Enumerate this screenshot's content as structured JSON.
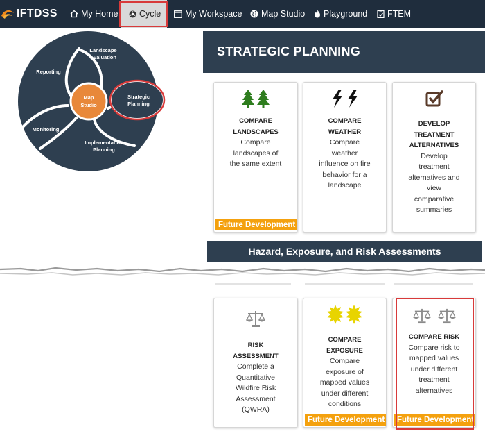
{
  "nav": {
    "brand": "IFTDSS",
    "items": [
      {
        "label": "My Home",
        "icon": "home-icon"
      },
      {
        "label": "Cycle",
        "icon": "cycle-icon",
        "active": true
      },
      {
        "label": "My Workspace",
        "icon": "window-icon"
      },
      {
        "label": "Map Studio",
        "icon": "globe-icon"
      },
      {
        "label": "Playground",
        "icon": "fire-icon"
      },
      {
        "label": "FTEM",
        "icon": "clipboard-icon"
      }
    ]
  },
  "cycle": {
    "center": [
      "Map",
      "Studio"
    ],
    "landscape": [
      "Landscape",
      "Evaluation"
    ],
    "reporting": "Reporting",
    "strategic": [
      "Strategic",
      "Planning"
    ],
    "monitoring": "Monitoring",
    "implementation": [
      "Implementation",
      "Planning"
    ]
  },
  "strategic": {
    "title": "STRATEGIC PLANNING",
    "cards": [
      {
        "title_lines": [
          "COMPARE",
          "LANDSCAPES"
        ],
        "desc_lines": [
          "Compare",
          "landscapes of",
          "the same extent"
        ],
        "icon": "tree-icon",
        "badge": "Future Development"
      },
      {
        "title_lines": [
          "COMPARE",
          "WEATHER"
        ],
        "desc_lines": [
          "Compare",
          "weather",
          "influence on fire",
          "behavior for a",
          "landscape"
        ],
        "icon": "lightning-icon"
      },
      {
        "title_lines": [
          "DEVELOP",
          "TREATMENT",
          "ALTERNATIVES"
        ],
        "desc_lines": [
          "Develop",
          "treatment",
          "alternatives and",
          "view",
          "comparative",
          "summaries"
        ],
        "icon": "checkbox-icon"
      }
    ]
  },
  "hazard": {
    "title": "Hazard, Exposure, and Risk Assessments",
    "cards": [
      {
        "title_lines": [
          "RISK",
          "ASSESSMENT"
        ],
        "desc_lines": [
          "Complete a",
          "Quantitative",
          "Wildfire Risk",
          "Assessment",
          "(QWRA)"
        ],
        "icon": "scale-icon"
      },
      {
        "title_lines": [
          "COMPARE",
          "EXPOSURE"
        ],
        "desc_lines": [
          "Compare",
          "exposure of",
          "mapped values",
          "under different",
          "conditions"
        ],
        "icon": "sun-icon",
        "badge": "Future Development"
      },
      {
        "title_lines": [
          "COMPARE RISK"
        ],
        "desc_lines": [
          "Compare risk to",
          "mapped values",
          "under different",
          "treatment",
          "alternatives"
        ],
        "icon": "scale-icon",
        "badge": "Future Development"
      }
    ]
  },
  "colors": {
    "navy": "#1f2d3d",
    "panel": "#2e3f50",
    "orange": "#e8883a",
    "badge": "#f4a10e",
    "tree": "#2e7d1e",
    "highlight": "#d83a3a"
  }
}
